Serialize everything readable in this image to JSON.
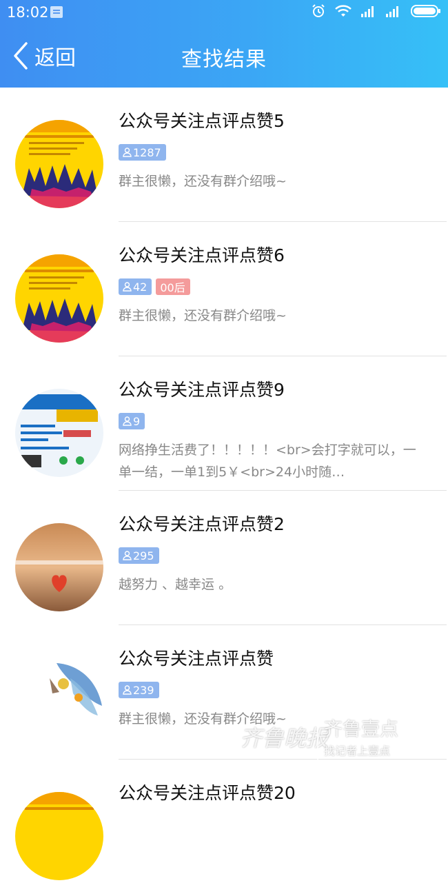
{
  "status_bar": {
    "time": "18:02",
    "icons": [
      "notification-icon",
      "alarm-icon",
      "wifi-icon",
      "signal-icon",
      "signal-icon",
      "battery-icon"
    ]
  },
  "nav": {
    "back_label": "返回",
    "title": "查找结果"
  },
  "groups": [
    {
      "name": "公众号关注点评点赞5",
      "members": "1287",
      "tag": "",
      "desc": "群主很懒，还没有群介绍哦~",
      "avatar": "yellow-poster-avatar"
    },
    {
      "name": "公众号关注点评点赞6",
      "members": "42",
      "tag": "00后",
      "desc": "群主很懒，还没有群介绍哦~",
      "avatar": "yellow-poster-avatar"
    },
    {
      "name": "公众号关注点评点赞9",
      "members": "9",
      "tag": "",
      "desc": "网络挣生活费了！！！！！<br>会打字就可以，一单一结，一单1到5￥<br>24小时随…",
      "avatar": "typing-ad-avatar"
    },
    {
      "name": "公众号关注点评点赞2",
      "members": "295",
      "tag": "",
      "desc": "越努力 、越幸运 。",
      "avatar": "heart-sunset-avatar"
    },
    {
      "name": "公众号关注点评点赞",
      "members": "239",
      "tag": "",
      "desc": "群主很懒，还没有群介绍哦~",
      "avatar": "painting-avatar"
    },
    {
      "name": "公众号关注点评点赞20",
      "members": "",
      "tag": "",
      "desc": "",
      "avatar": "yellow-poster-avatar"
    }
  ],
  "watermark": {
    "left": "齐鲁晚报",
    "brand": "齐鲁壹点",
    "sub": "找记者上壹点"
  }
}
